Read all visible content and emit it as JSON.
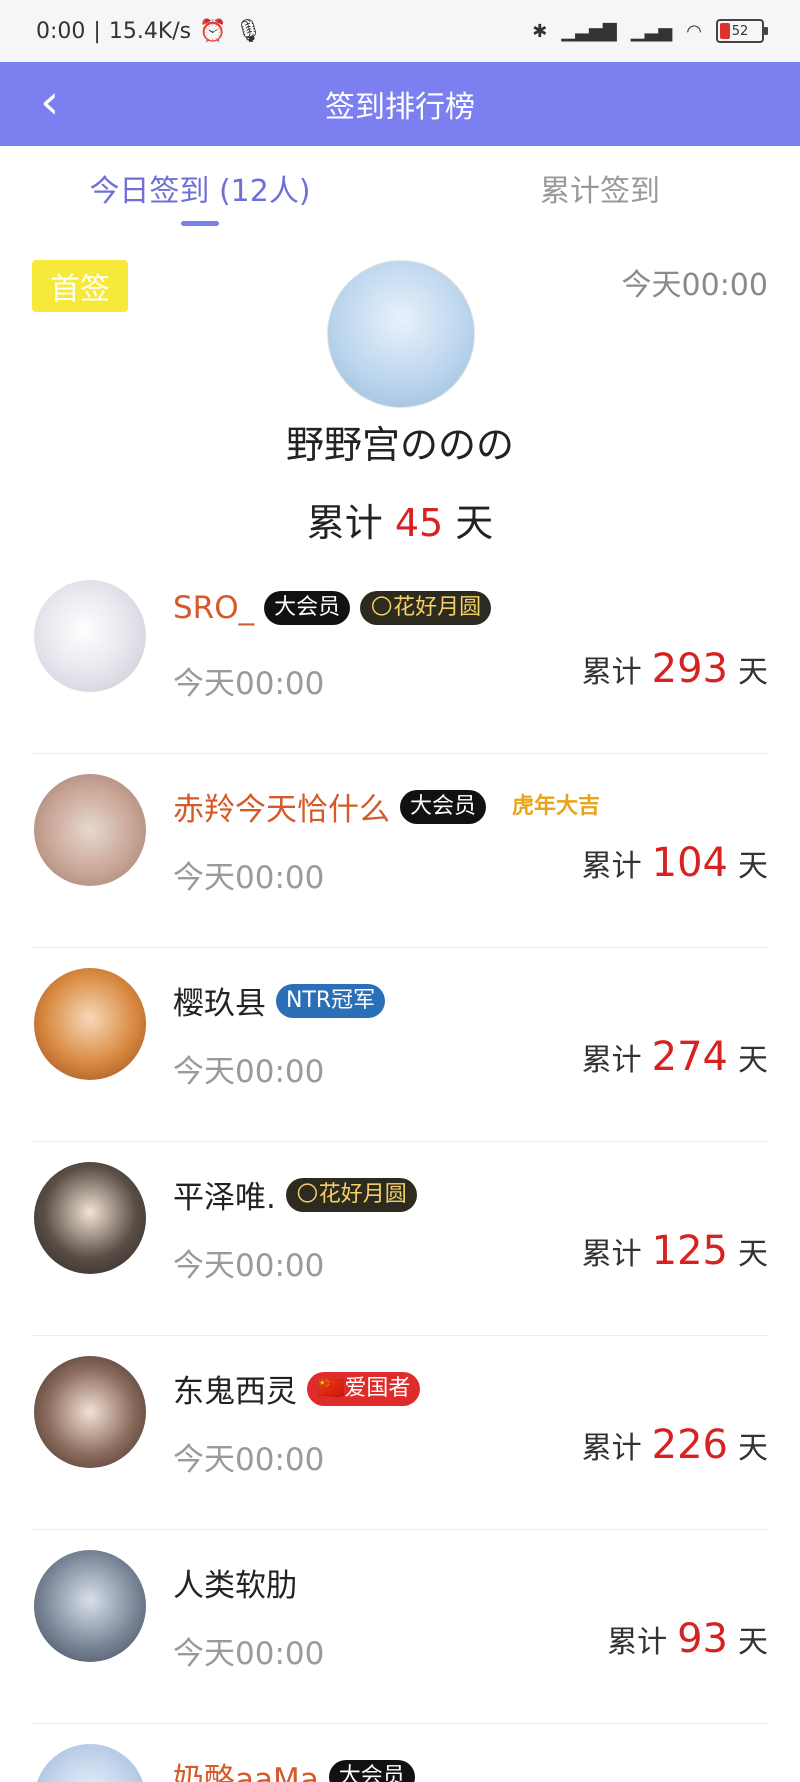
{
  "status_bar": {
    "time": "0:00",
    "speed": "15.4K/s",
    "battery": "52"
  },
  "header": {
    "title": "签到排行榜"
  },
  "tabs": [
    {
      "label": "今日签到 (12人)"
    },
    {
      "label": "累计签到"
    }
  ],
  "first_sign": {
    "badge": "首签",
    "time": "今天00:00",
    "name": "野野宫ののの",
    "total_prefix": "累计",
    "total_days": "45",
    "total_suffix": "天"
  },
  "colors": {
    "accent": "#7b7ff0",
    "highlight_red": "#d82222",
    "orange_name": "#d45a2a"
  },
  "rows": [
    {
      "name": "SRO_",
      "badges": [
        "大会员",
        "花好月圆"
      ],
      "time": "今天00:00",
      "total_prefix": "累计",
      "days": "293",
      "suffix": "天"
    },
    {
      "name": "赤羚今天恰什么",
      "badges": [
        "大会员",
        "虎年大吉"
      ],
      "time": "今天00:00",
      "total_prefix": "累计",
      "days": "104",
      "suffix": "天"
    },
    {
      "name": "樱玖县",
      "badges": [
        "NTR冠军"
      ],
      "time": "今天00:00",
      "total_prefix": "累计",
      "days": "274",
      "suffix": "天"
    },
    {
      "name": "平泽唯.",
      "badges": [
        "花好月圆"
      ],
      "time": "今天00:00",
      "total_prefix": "累计",
      "days": "125",
      "suffix": "天"
    },
    {
      "name": "东鬼西灵",
      "badges": [
        "爱国者"
      ],
      "time": "今天00:00",
      "total_prefix": "累计",
      "days": "226",
      "suffix": "天"
    },
    {
      "name": "人类软肋",
      "badges": [],
      "time": "今天00:00",
      "total_prefix": "累计",
      "days": "93",
      "suffix": "天"
    },
    {
      "name": "奶酪aaMa",
      "badges": [
        "大会员"
      ],
      "time": "",
      "total_prefix": "",
      "days": "",
      "suffix": ""
    }
  ]
}
